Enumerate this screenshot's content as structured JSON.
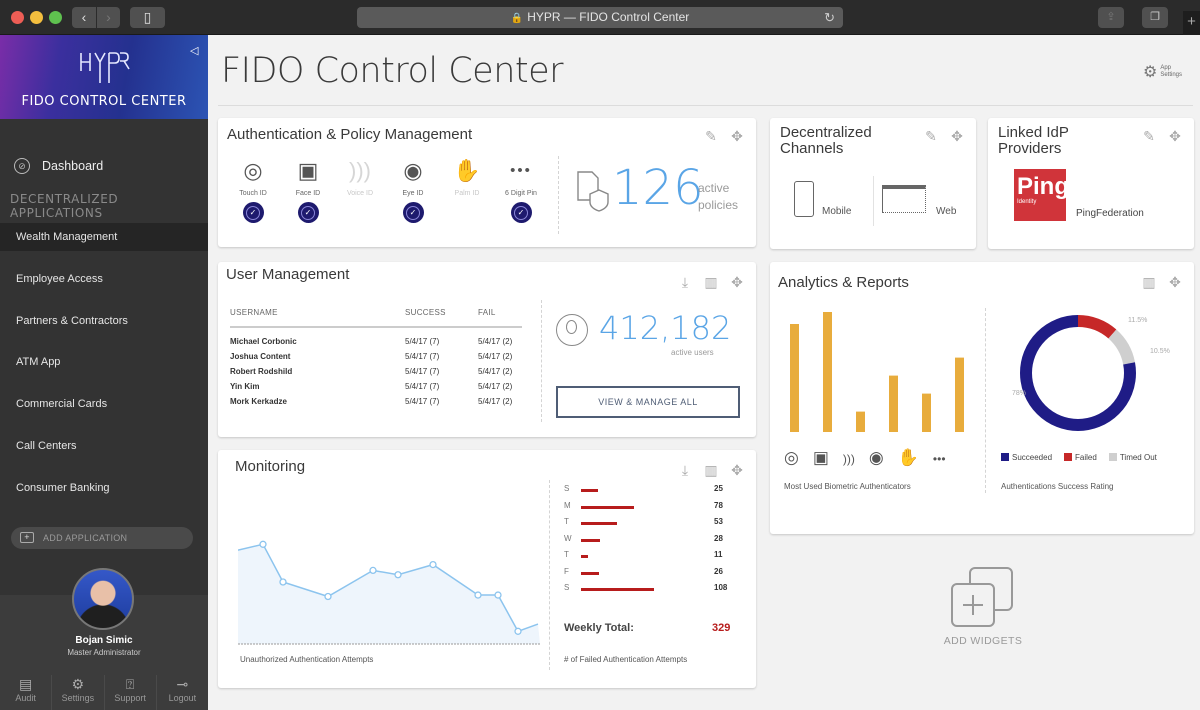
{
  "browser": {
    "address_title": "HYPR — FIDO Control Center",
    "back_label": "‹",
    "forward_label": "›"
  },
  "sidebar": {
    "brand_logo_text": "HYPR",
    "brand_title": "FIDO CONTROL CENTER",
    "dashboard_label": "Dashboard",
    "section_label": "DECENTRALIZED APPLICATIONS",
    "apps": [
      {
        "label": "Wealth Management",
        "active": true
      },
      {
        "label": "Employee Access",
        "active": false
      },
      {
        "label": "Partners & Contractors",
        "active": false
      },
      {
        "label": "ATM App",
        "active": false
      },
      {
        "label": "Commercial Cards",
        "active": false
      },
      {
        "label": "Call Centers",
        "active": false
      },
      {
        "label": "Consumer Banking",
        "active": false
      }
    ],
    "add_application_label": "ADD APPLICATION",
    "user": {
      "name": "Bojan Simic",
      "role": "Master Administrator"
    },
    "bottom_nav": [
      {
        "label": "Audit",
        "icon": "audit-icon"
      },
      {
        "label": "Settings",
        "icon": "gear-icon"
      },
      {
        "label": "Support",
        "icon": "help-icon"
      },
      {
        "label": "Logout",
        "icon": "logout-icon"
      }
    ]
  },
  "header": {
    "title": "FIDO Control Center",
    "app_settings_line1": "App",
    "app_settings_line2": "Settings"
  },
  "auth_card": {
    "title": "Authentication & Policy Management",
    "methods": [
      {
        "label": "Touch ID",
        "enabled": true,
        "icon": "fingerprint-icon"
      },
      {
        "label": "Face ID",
        "enabled": true,
        "icon": "face-icon"
      },
      {
        "label": "Voice ID",
        "enabled": false,
        "icon": "voice-icon"
      },
      {
        "label": "Eye ID",
        "enabled": true,
        "icon": "eye-icon"
      },
      {
        "label": "Palm ID",
        "enabled": false,
        "icon": "palm-icon"
      },
      {
        "label": "6 Digit Pin",
        "enabled": true,
        "icon": "pin-icon"
      }
    ],
    "policies_count": "126",
    "policies_label_1": "active",
    "policies_label_2": "policies"
  },
  "channels_card": {
    "title_1": "Decentralized",
    "title_2": "Channels",
    "channels": [
      {
        "label": "Mobile"
      },
      {
        "label": "Web"
      }
    ]
  },
  "idp_card": {
    "title_1": "Linked IdP",
    "title_2": "Providers",
    "logo_text": "Ping",
    "logo_subtext": "Identity",
    "provider_label": "PingFederation",
    "brand_color": "#d0343a"
  },
  "user_mgmt": {
    "title": "User Management",
    "columns": [
      "USERNAME",
      "SUCCESS",
      "FAIL"
    ],
    "rows": [
      {
        "name": "Michael Corbonic",
        "success": "5/4/17 (7)",
        "fail": "5/4/17 (2)"
      },
      {
        "name": "Joshua Content",
        "success": "5/4/17 (7)",
        "fail": "5/4/17 (2)"
      },
      {
        "name": "Robert Rodshild",
        "success": "5/4/17 (7)",
        "fail": "5/4/17 (2)"
      },
      {
        "name": "Yin Kim",
        "success": "5/4/17 (7)",
        "fail": "5/4/17 (2)"
      },
      {
        "name": "Mork Kerkadze",
        "success": "5/4/17 (7)",
        "fail": "5/4/17 (2)"
      }
    ],
    "active_users": "412,182",
    "active_users_label": "active users",
    "view_all_label": "VIEW & MANAGE ALL"
  },
  "monitoring": {
    "title": "Monitoring",
    "line_caption": "Unauthorized Authentication Attempts",
    "line_values": [
      62,
      66,
      40,
      30,
      48,
      45,
      52,
      31,
      31,
      6,
      11
    ],
    "failed_caption": "# of Failed Authentication Attempts",
    "failed": [
      {
        "day": "S",
        "value": 25
      },
      {
        "day": "M",
        "value": 78
      },
      {
        "day": "T",
        "value": 53
      },
      {
        "day": "W",
        "value": 28
      },
      {
        "day": "T",
        "value": 11
      },
      {
        "day": "F",
        "value": 26
      },
      {
        "day": "S",
        "value": 108
      }
    ],
    "weekly_total_label": "Weekly Total:",
    "weekly_total": "329",
    "accent": "#b71c1c"
  },
  "analytics": {
    "title": "Analytics & Reports",
    "bar_caption": "Most Used Biometric Authenticators",
    "bar_values": [
      90,
      100,
      17,
      47,
      32,
      62
    ],
    "bar_color": "#e8ac3c",
    "donut_caption": "Authentications Success Rating",
    "donut": [
      {
        "label": "Succeeded",
        "value": 78,
        "display": "78%",
        "color": "#1f1c86"
      },
      {
        "label": "Failed",
        "value": 11.5,
        "display": "11.5%",
        "color": "#c62828"
      },
      {
        "label": "Timed Out",
        "value": 10.5,
        "display": "10.5%",
        "color": "#cfcfcf"
      }
    ]
  },
  "add_widgets_label": "ADD WIDGETS"
}
